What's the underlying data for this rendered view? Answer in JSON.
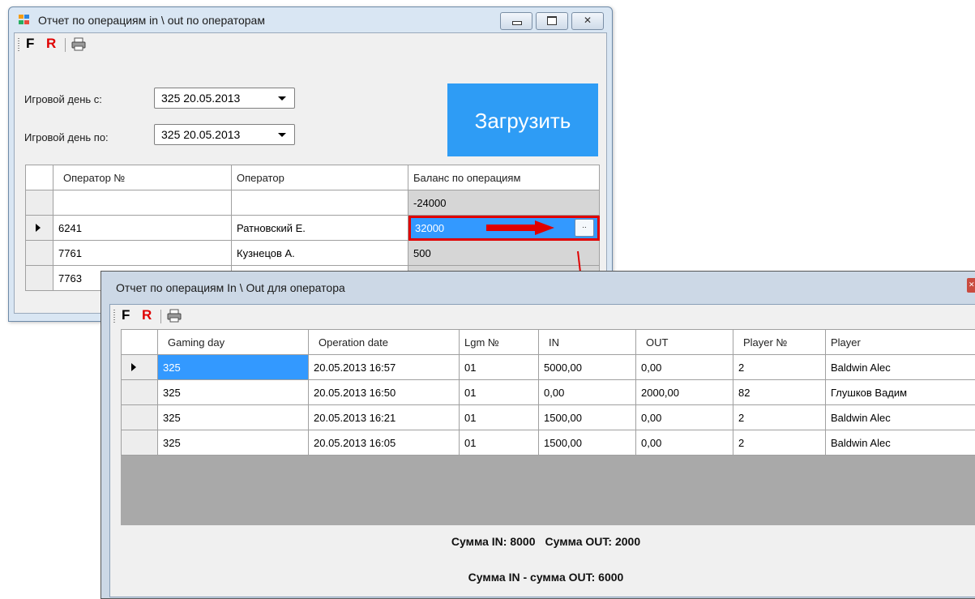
{
  "window1": {
    "title": "Отчет по операциям in \\ out по операторам",
    "toolbar": {
      "f_label": "F",
      "r_label": "R",
      "print_icon": "printer-icon"
    },
    "day_from_label": "Игровой день с:",
    "day_from_value": "325 20.05.2013",
    "day_to_label": "Игровой день по:",
    "day_to_value": "325 20.05.2013",
    "load_button": "Загрузить",
    "table": {
      "headers": [
        "Оператор №",
        "Оператор",
        "Баланс по операциям"
      ],
      "rows": [
        [
          "",
          "",
          "-24000"
        ],
        [
          "6241",
          "Ратновский Е.",
          "32000"
        ],
        [
          "7761",
          "Кузнецов А.",
          "500"
        ],
        [
          "7763",
          "",
          ""
        ]
      ],
      "detail_button": ".."
    }
  },
  "window2": {
    "title": "Отчет по операциям In \\ Out для оператора",
    "toolbar": {
      "f_label": "F",
      "r_label": "R",
      "print_icon": "printer-icon"
    },
    "table": {
      "headers": [
        "Gaming day",
        "Operation date",
        "Lgm №",
        "IN",
        "OUT",
        "Player №",
        "Player"
      ],
      "rows": [
        [
          "325",
          "20.05.2013 16:57",
          "01",
          "5000,00",
          "0,00",
          "2",
          "Baldwin Alec"
        ],
        [
          "325",
          "20.05.2013 16:50",
          "01",
          "0,00",
          "2000,00",
          "82",
          "Глушков Вадим"
        ],
        [
          "325",
          "20.05.2013 16:21",
          "01",
          "1500,00",
          "0,00",
          "2",
          "Baldwin Alec"
        ],
        [
          "325",
          "20.05.2013 16:05",
          "01",
          "1500,00",
          "0,00",
          "2",
          "Baldwin Alec"
        ]
      ]
    },
    "sum_in": "Сумма IN: 8000",
    "sum_out": "Сумма OUT: 2000",
    "sum_diff": "Сумма IN - сумма OUT: 6000"
  },
  "colors": {
    "accent_button": "#2e9cf5",
    "highlight": "#e00000",
    "selection": "#3399ff"
  }
}
